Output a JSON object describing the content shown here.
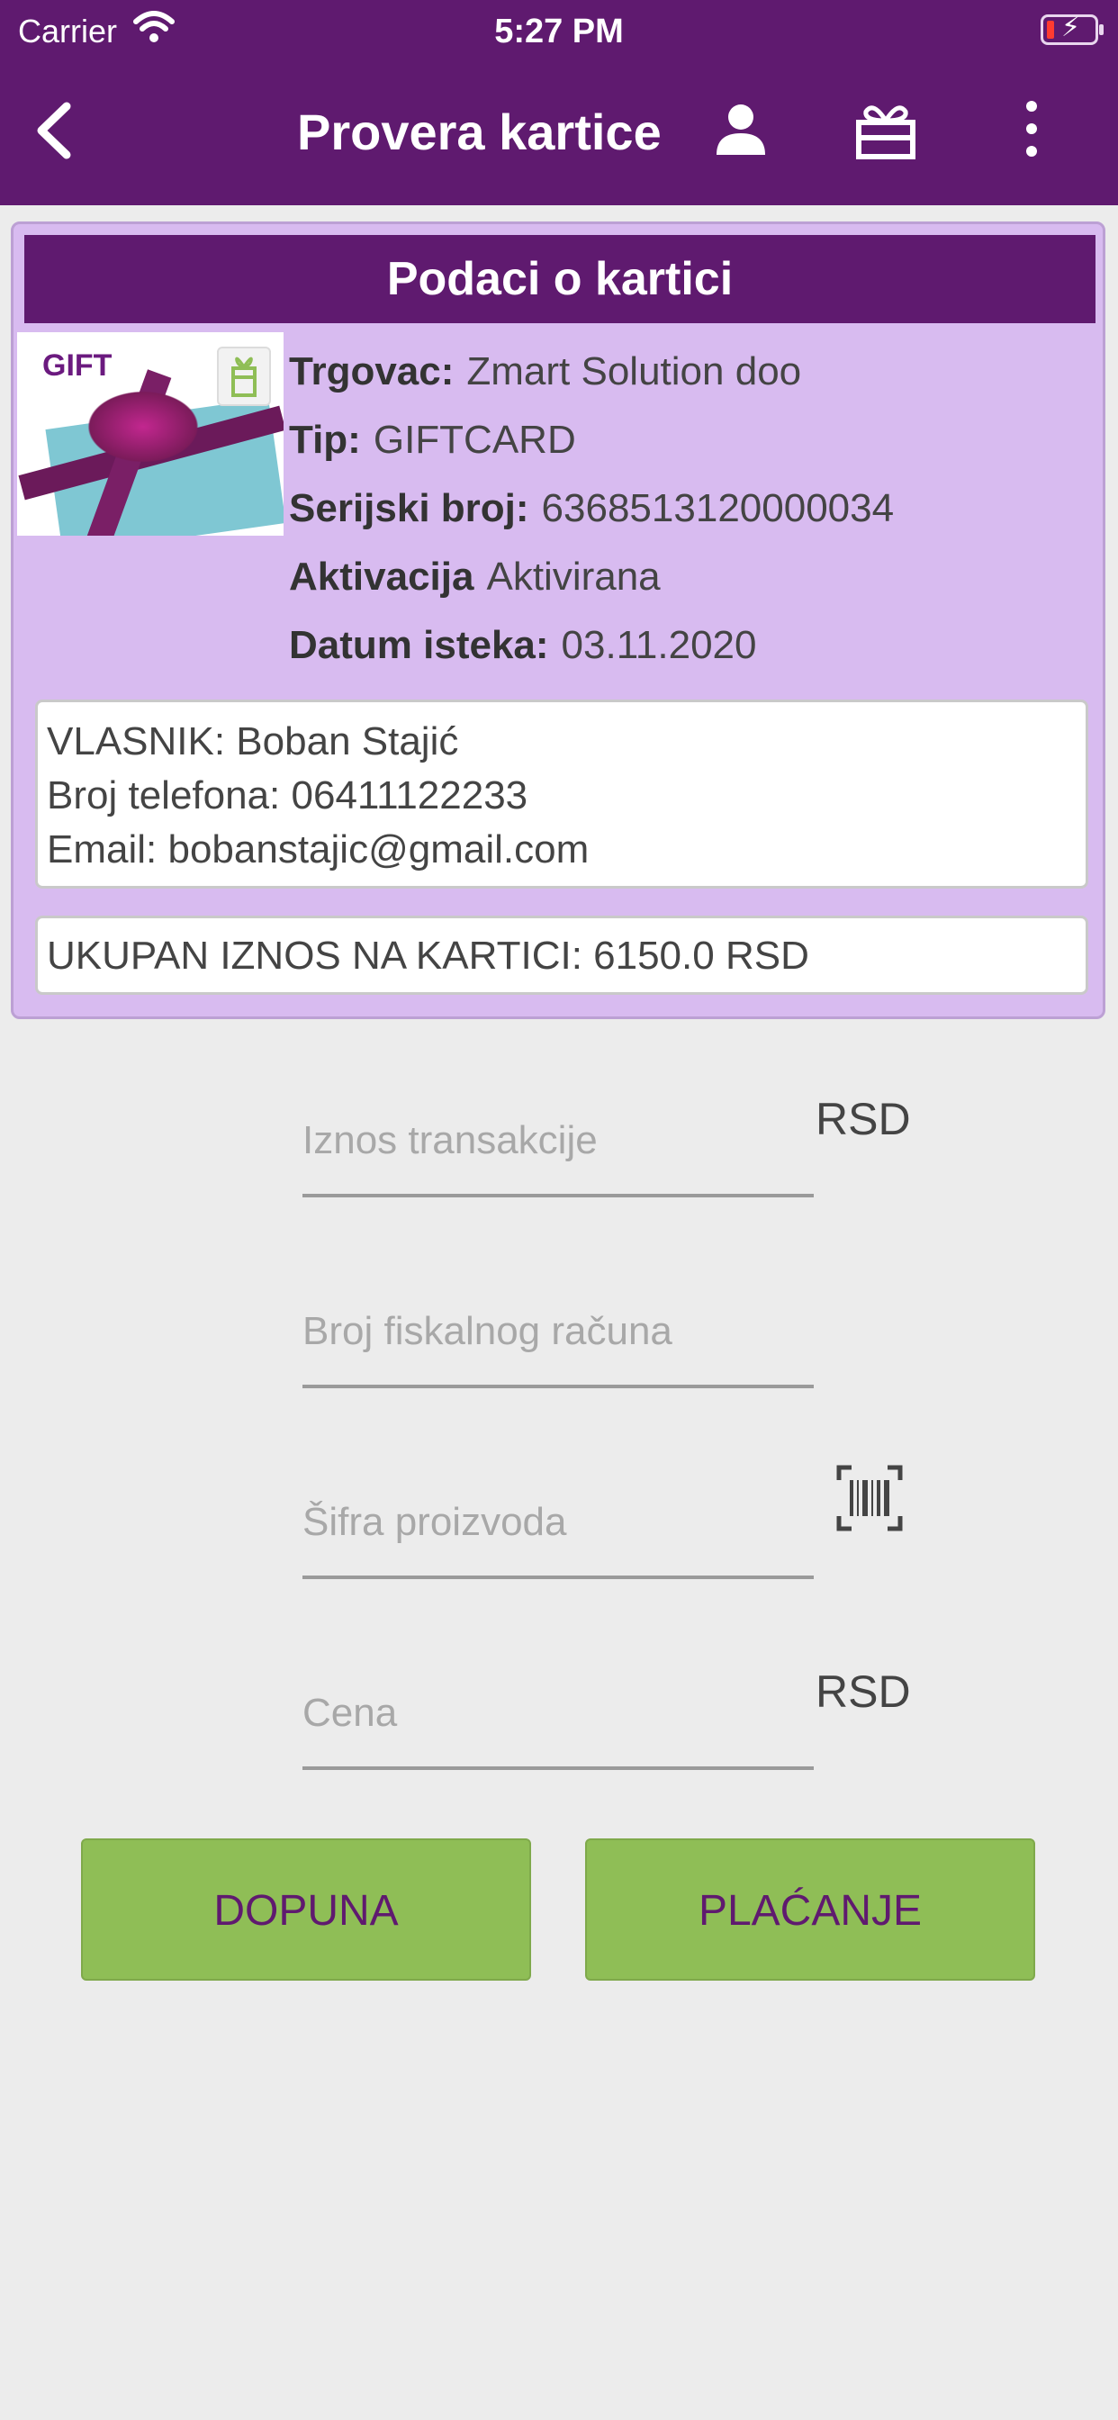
{
  "status_bar": {
    "carrier": "Carrier",
    "time": "5:27 PM"
  },
  "nav": {
    "title": "Provera kartice",
    "icons": [
      "back-chevron-icon",
      "user-icon",
      "gift-icon",
      "more-vertical-icon"
    ]
  },
  "card": {
    "header": "Podaci o kartici",
    "image_label": "GIFT",
    "merchant_label": "Trgovac:",
    "merchant_value": "Zmart Solution doo",
    "type_label": "Tip:",
    "type_value": "GIFTCARD",
    "serial_label": "Serijski broj:",
    "serial_value": "6368513120000034",
    "activation_label": "Aktivacija",
    "activation_value": "Aktivirana",
    "expiry_label": "Datum isteka:",
    "expiry_value": "03.11.2020",
    "owner": "VLASNIK: Boban Stajić",
    "phone": "Broj telefona: 06411122233",
    "email": "Email: bobanstajic@gmail.com",
    "total": "UKUPAN IZNOS NA KARTICI: 6150.0 RSD"
  },
  "form": {
    "amount_placeholder": "Iznos transakcije",
    "amount_unit": "RSD",
    "receipt_placeholder": "Broj fiskalnog računa",
    "product_placeholder": "Šifra proizvoda",
    "price_placeholder": "Cena",
    "price_unit": "RSD"
  },
  "buttons": {
    "topup": "DOPUNA",
    "pay": "PLAĆANJE"
  },
  "colors": {
    "primary": "#5f1a6f",
    "card_bg": "#d8bbf0",
    "button": "#8fbe56",
    "background": "#ececec"
  }
}
